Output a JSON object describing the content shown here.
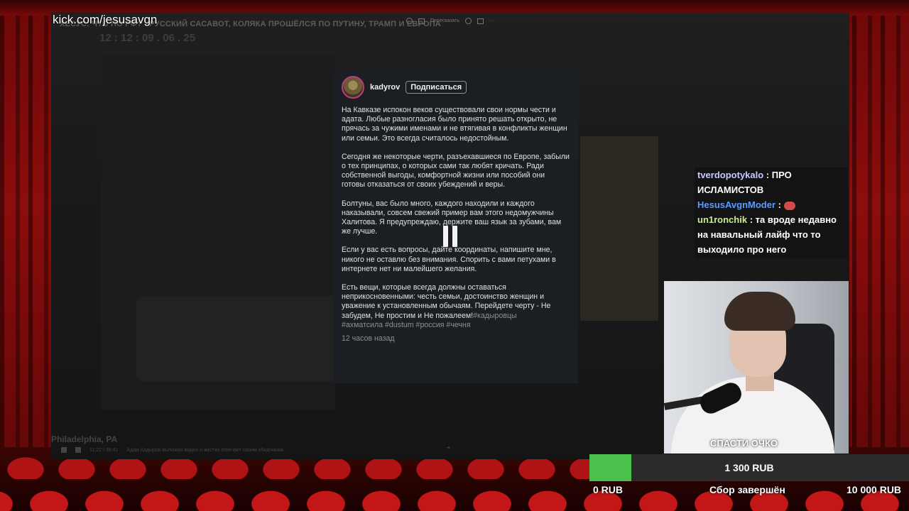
{
  "stream": {
    "channel_url": "kick.com/jesusavgn"
  },
  "video": {
    "title": "ХЕСУС: ЧТО ПО РФ? - РУССКИЙ САСАВОТ, КОЛЯКА ПРОШЁЛСЯ ПО ПУТИНУ, ТРАМП И ЕВРОПА",
    "subtitle": "12 : 12 : 09 . 06 . 25",
    "share_label": "Пересказать",
    "location": "Philadelphia, PA",
    "time": "11:22 / 38:41",
    "caption": "Адам Кадыров выложил видео и жестко отвечает своим обидчикам"
  },
  "post": {
    "username": "kadyrov",
    "subscribe_label": "Подписаться",
    "paragraphs": [
      "На Кавказе испокон веков существовали свои нормы чести и адата. Любые разногласия было принято решать открыто, не прячась за чужими именами и не втягивая в конфликты женщин или семьи. Это всегда считалось недостойным.",
      "Сегодня же некоторые черти, разъехавшиеся по Европе, забыли о тех принципах, о которых сами так любят кричать. Ради собственной выгоды, комфортной жизни или пособий они готовы отказаться от своих убеждений и веры.",
      "Болтуны, вас было много, каждого находили и каждого наказывали, совсем свежий пример вам этого недомужчины Халитова. Я предупреждаю, держите ваш язык за зубами, вам же лучше.",
      "Если у вас есть вопросы, дайте координаты, напишите мне, никого не оставлю без внимания. Спорить с вами петухами в интернете нет ни малейшего желания.",
      "Есть вещи, которые всегда должны оставаться неприкосновенными: честь семьи, достоинство женщин и уважение к установленным обычаям. Перейдете черту - Не забудем, Не простим и Не пожалеем!"
    ],
    "tags_inline": "#кадыровцы",
    "tags_line": "#ахматсила #dustum #россия #чечня",
    "time_ago": "12 часов назад"
  },
  "chat": [
    {
      "user": "tverdopotykalo",
      "text": "ПРО ИСЛАМИСТОВ"
    },
    {
      "user": "HesusAvgnModer",
      "text": ""
    },
    {
      "user": "un1ronchik",
      "text": "та вроде недавно на навальный лайф что то выходило про него"
    }
  ],
  "goal": {
    "title": "СПАСТИ ОЧКО",
    "current": "1 300 RUB",
    "min": "0 RUB",
    "max": "10 000 RUB",
    "status": "Сбор завершён",
    "progress_fraction": 0.13
  },
  "colors": {
    "post_bg": "#1b1e22",
    "goal_fill": "#4bc14b",
    "curtain": "#8c0d0d",
    "chat_user_2": "#5b9bff",
    "chat_user_3": "#c8f08a"
  }
}
